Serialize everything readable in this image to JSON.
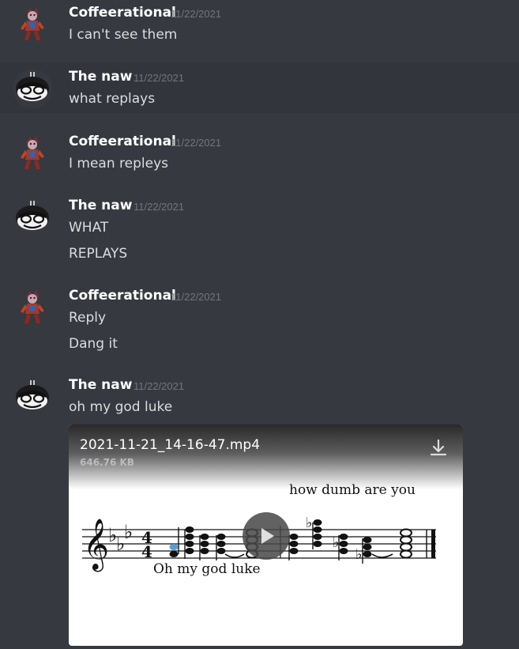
{
  "messages": [
    {
      "author": "Coffeerational",
      "timestamp": "11/22/2021",
      "lines": [
        "I can't see them"
      ]
    },
    {
      "author": "The naw",
      "timestamp": "11/22/2021",
      "lines": [
        "what replays"
      ]
    },
    {
      "author": "Coffeerational",
      "timestamp": "11/22/2021",
      "lines": [
        "I mean repleys"
      ]
    },
    {
      "author": "The naw",
      "timestamp": "11/22/2021",
      "lines": [
        "WHAT",
        "REPLAYS"
      ]
    },
    {
      "author": "Coffeerational",
      "timestamp": "11/22/2021",
      "lines": [
        "Reply",
        "Dang it"
      ]
    },
    {
      "author": "The naw",
      "timestamp": "11/22/2021",
      "lines": [
        "oh my god luke"
      ]
    }
  ],
  "attachment": {
    "filename": "2021-11-21_14-16-47.mp4",
    "size": "646.76 KB",
    "caption_top": "how dumb are you",
    "caption_bottom": "Oh my god luke",
    "download_icon": "download-icon",
    "play_icon": "play-icon"
  },
  "colors": {
    "background": "#36393f",
    "hover_row": "#32353b",
    "username": "#ffffff",
    "message_text": "#dcddde",
    "timestamp": "#72767d"
  }
}
